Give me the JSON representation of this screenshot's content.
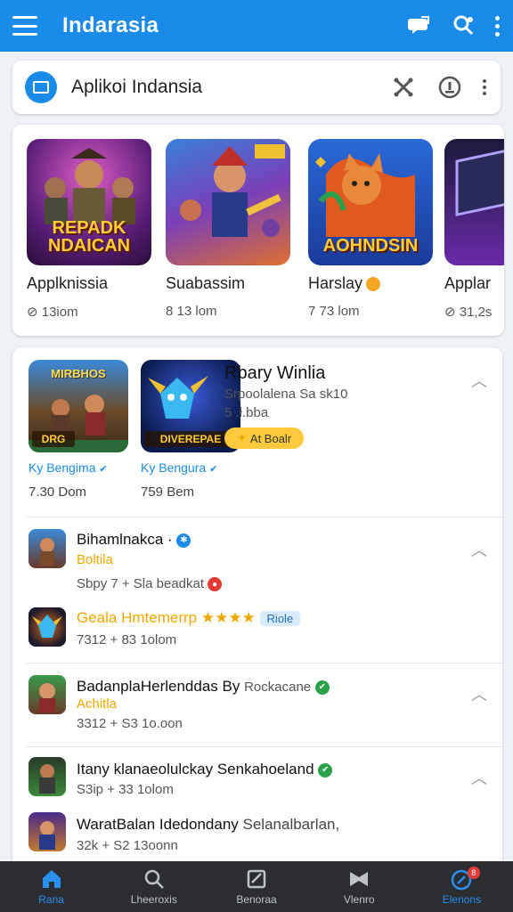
{
  "app": {
    "title": "Indarasia"
  },
  "search": {
    "title": "Aplikoi Indansia"
  },
  "carousel": [
    {
      "name": "Applknissia",
      "meta": "⊘ 13iom",
      "banner": "REPADK NDAICAN",
      "verified": false
    },
    {
      "name": "Suabassim",
      "meta": "8 13 lom",
      "banner": "",
      "verified": false
    },
    {
      "name": "Harslay",
      "meta": "7 73 lom",
      "banner": "AOHNDSIN",
      "verified": true
    },
    {
      "name": "Applar",
      "meta": "⊘ 31,2s",
      "banner": "",
      "verified": false
    }
  ],
  "featured": {
    "left": {
      "label": "DRG",
      "top": "MIRBHOS",
      "dev": "Ky Bengima",
      "size": "7.30 Dom"
    },
    "right": {
      "label": "DIVEREPAE",
      "dev": "Ky Bengura",
      "size": "759 Bem"
    },
    "title": "Rbary Winlia",
    "sub1": "Srpoolalena Sa sk10",
    "sub2": "5 .ł.bba",
    "pill": "At Boalr"
  },
  "rows": [
    {
      "title": "Bihamlnakca ·",
      "sub": "Boltila",
      "meta": "Sbpy 7 + Sla beadkat"
    },
    {
      "title": "Geala Hmtemerrp",
      "tag": "Riole",
      "meta": "7312 + 83 1olom"
    },
    {
      "title": "BadanplaHerlenddas By",
      "title2": "Rockacane",
      "sub": "Achitla",
      "meta": "3312 + S3 1o.oon"
    },
    {
      "title": "Itany klanaeolulckay Senkahoeland",
      "meta": "S3ip + 33 1olom"
    },
    {
      "title": "WaratBalan Idedondany",
      "title2": "Selanalbarlan,",
      "meta": "32k + S2 13oonn"
    }
  ],
  "nav": [
    {
      "label": "Rana",
      "icon": "home-icon"
    },
    {
      "label": "Lheeroxis",
      "icon": "search-icon"
    },
    {
      "label": "Benoraa",
      "icon": "library-icon"
    },
    {
      "label": "Vlenro",
      "icon": "games-icon"
    },
    {
      "label": "Elenons",
      "icon": "profile-icon",
      "badge": "8"
    }
  ],
  "colors": {
    "primary": "#1a8be8",
    "accent": "#f0a800",
    "navbar": "#2b2d31"
  }
}
